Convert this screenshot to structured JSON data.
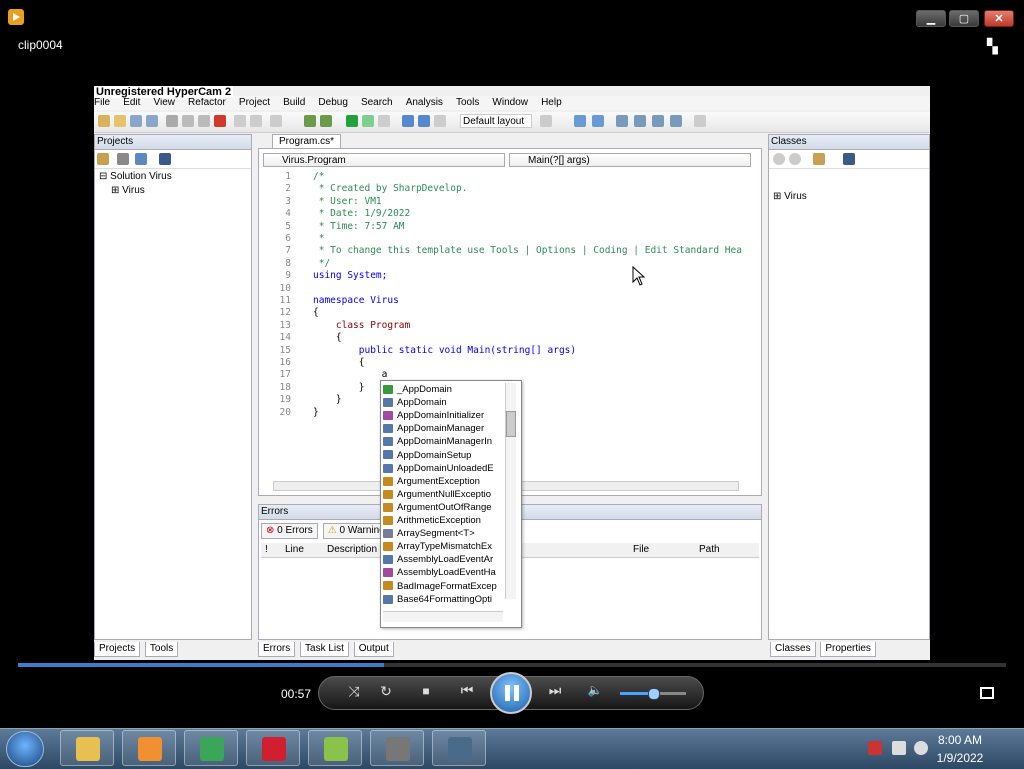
{
  "window": {
    "title": "clip0004",
    "minimize_glyph": "▁",
    "maximize_glyph": "▢",
    "close_glyph": "✕",
    "switch_glyph": "▚"
  },
  "ide": {
    "watermark": "Unregistered HyperCam 2",
    "menu": [
      "File",
      "Edit",
      "View",
      "Refactor",
      "Project",
      "Build",
      "Debug",
      "Search",
      "Analysis",
      "Tools",
      "Window",
      "Help"
    ],
    "layout_select": "Default layout",
    "projects": {
      "header": "Projects",
      "tree": [
        "Solution Virus",
        "Virus"
      ],
      "bottom_tabs": [
        "Projects",
        "Tools"
      ]
    },
    "classes": {
      "header": "Classes",
      "tree": [
        "Virus"
      ],
      "bottom_tabs": [
        "Classes",
        "Properties"
      ]
    },
    "editor": {
      "tab": "Program.cs*",
      "combo_left": "Virus.Program",
      "combo_right": "Main(?[] args)",
      "lines": [
        {
          "n": "1",
          "t": "/*",
          "c": "cm"
        },
        {
          "n": "2",
          "t": " * Created by SharpDevelop.",
          "c": "cm"
        },
        {
          "n": "3",
          "t": " * User: VM1",
          "c": "cm"
        },
        {
          "n": "4",
          "t": " * Date: 1/9/2022",
          "c": "cm"
        },
        {
          "n": "5",
          "t": " * Time: 7:57 AM",
          "c": "cm"
        },
        {
          "n": "6",
          "t": " *",
          "c": "cm"
        },
        {
          "n": "7",
          "t": " * To change this template use Tools | Options | Coding | Edit Standard Hea",
          "c": "cm"
        },
        {
          "n": "8",
          "t": " */",
          "c": "cm"
        },
        {
          "n": "9",
          "t": "using System;",
          "c": "kw"
        },
        {
          "n": "10",
          "t": "",
          "c": ""
        },
        {
          "n": "11",
          "t": "namespace Virus",
          "c": "kw"
        },
        {
          "n": "12",
          "t": "{",
          "c": ""
        },
        {
          "n": "13",
          "t": "    class Program",
          "c": "kw2"
        },
        {
          "n": "14",
          "t": "    {",
          "c": ""
        },
        {
          "n": "15",
          "t": "        public static void Main(string[] args)",
          "c": "kw"
        },
        {
          "n": "16",
          "t": "        {",
          "c": ""
        },
        {
          "n": "17",
          "t": "            a",
          "c": ""
        },
        {
          "n": "18",
          "t": "        }",
          "c": ""
        },
        {
          "n": "19",
          "t": "    }",
          "c": ""
        },
        {
          "n": "20",
          "t": "}",
          "c": ""
        }
      ]
    },
    "autocomplete": [
      "_AppDomain",
      "AppDomain",
      "AppDomainInitializer",
      "AppDomainManager",
      "AppDomainManagerIn",
      "AppDomainSetup",
      "AppDomainUnloadedE",
      "ArgumentException",
      "ArgumentNullExceptio",
      "ArgumentOutOfRange",
      "ArithmeticException",
      "ArraySegment<T>",
      "ArrayTypeMismatchEx",
      "AssemblyLoadEventAr",
      "AssemblyLoadEventHa",
      "BadImageFormatExcep",
      "Base64FormattingOpti"
    ],
    "errors": {
      "header": "Errors",
      "tabs": [
        "0 Errors",
        "0 Warning"
      ],
      "columns": [
        "!",
        "Line",
        "Description",
        "File",
        "Path"
      ],
      "bottom_tabs": [
        "Errors",
        "Task List",
        "Output"
      ]
    }
  },
  "player": {
    "time": "00:57",
    "progress_fraction": 0.37,
    "volume_fraction": 0.5,
    "icons": {
      "shuffle": "⤨",
      "repeat": "↻",
      "stop": "■",
      "prev": "⏮",
      "next": "⏭",
      "volume": "🔈"
    }
  },
  "taskbar": {
    "clock_time": "8:00 AM",
    "clock_date": "1/9/2022",
    "apps": [
      "Windows Explorer",
      "Windows Media Player",
      "Google Chrome",
      "Audacity",
      "Notepad++",
      "App",
      "SharpDevelop"
    ],
    "app_colors": [
      "#e8c050",
      "#f09030",
      "#3aa657",
      "#d02030",
      "#8bc34a",
      "#777777",
      "#4a6a8a"
    ]
  }
}
